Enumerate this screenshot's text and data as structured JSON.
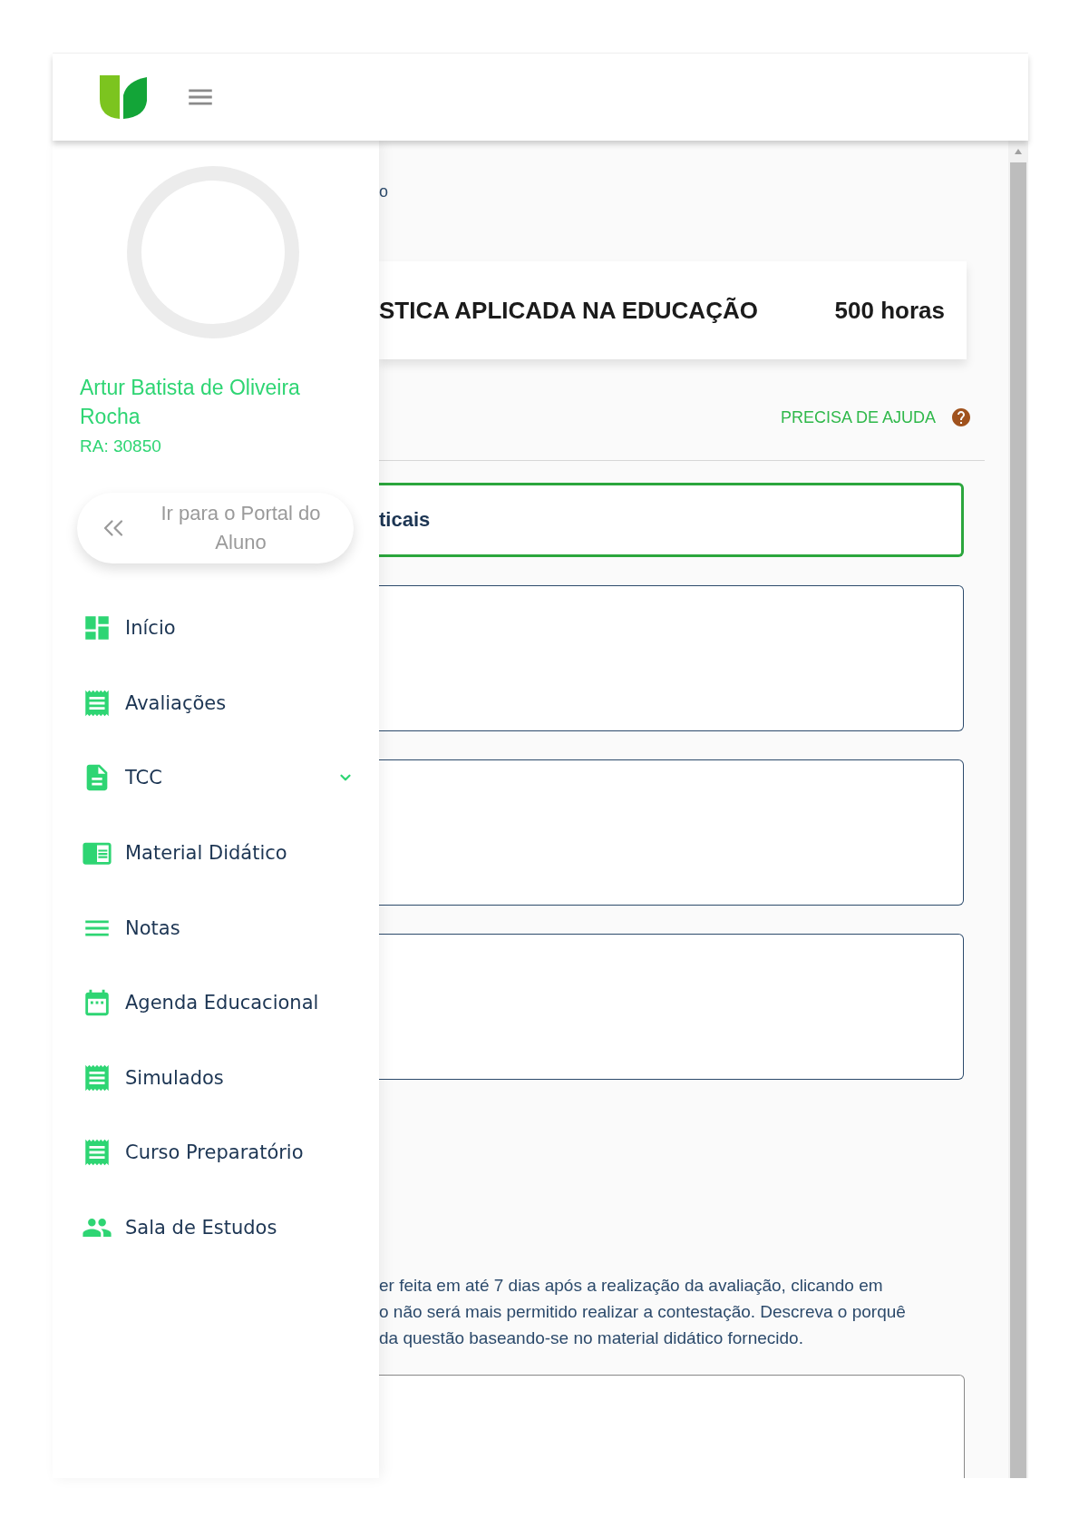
{
  "profile": {
    "name": "Artur Batista de Oliveira Rocha",
    "ra": "RA: 30850"
  },
  "portal_button": {
    "label": "Ir para o Portal do Aluno"
  },
  "menu": [
    {
      "label": "Início",
      "kind": "link"
    },
    {
      "label": "Avaliações",
      "kind": "link"
    },
    {
      "label": "TCC",
      "kind": "group",
      "expanded": false
    },
    {
      "label": "Material Didático",
      "kind": "link"
    },
    {
      "label": "Notas",
      "kind": "link"
    },
    {
      "label": "Agenda Educacional",
      "kind": "link"
    },
    {
      "label": "Simulados",
      "kind": "link"
    },
    {
      "label": "Curso Preparatório",
      "kind": "link"
    },
    {
      "label": "Sala de Estudos",
      "kind": "link"
    }
  ],
  "content": {
    "breadcrumb": "o",
    "course_card": {
      "title": "STICA APLICADA NA EDUCAÇÃO",
      "hours": "500 horas"
    },
    "help_link": "PRECISA DE AJUDA",
    "selected_option": "ticais",
    "instructions": [
      "er feita em até 7 dias após a realização da avaliação, clicando em",
      "o não será mais permitido realizar a contestação. Descreva o porquê",
      "da questão baseando-se no material didático fornecido."
    ]
  }
}
